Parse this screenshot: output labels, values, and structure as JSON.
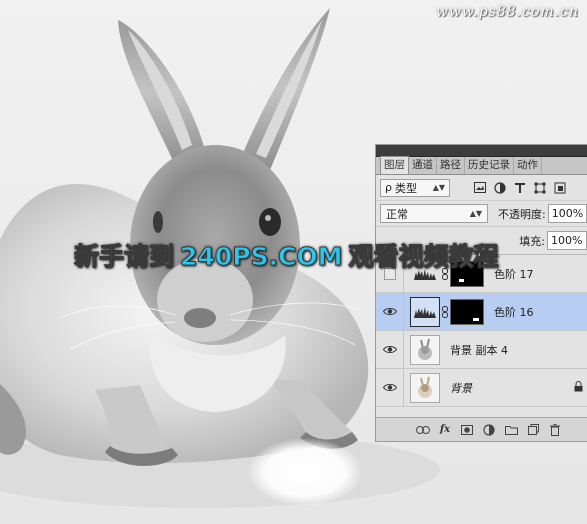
{
  "site_watermark": "www.ps88.com.cn",
  "overlay_text": {
    "part1": "新手请到",
    "part2": "240PS.COM",
    "part3": "观看视频教程"
  },
  "colors": {
    "overlay_accent": "#29c6ee",
    "selected_row": "#b7cdf1",
    "panel_bg": "#e3e3e3"
  },
  "panel": {
    "tabs": [
      {
        "label": "图层",
        "active": true
      },
      {
        "label": "通道",
        "active": false
      },
      {
        "label": "路径",
        "active": false
      },
      {
        "label": "历史记录",
        "active": false
      },
      {
        "label": "动作",
        "active": false
      }
    ],
    "filter": {
      "search_glyph": "ρ",
      "kind_value": "类型",
      "icons": [
        "image-filter-icon",
        "adjustment-filter-icon",
        "type-filter-icon",
        "shape-filter-icon",
        "smart-object-filter-icon"
      ]
    },
    "blend_mode": "正常",
    "opacity_label": "不透明度:",
    "opacity_value": "100%",
    "fill_label": "填充:",
    "fill_value": "100%",
    "layers": [
      {
        "name": "色阶 17",
        "visible": false,
        "selected": false,
        "type": "levels-adjustment"
      },
      {
        "name": "色阶 16",
        "visible": true,
        "selected": true,
        "type": "levels-adjustment"
      },
      {
        "name": "背景 副本 4",
        "visible": true,
        "selected": false,
        "type": "pixel"
      },
      {
        "name": "背景",
        "visible": true,
        "selected": false,
        "type": "background",
        "locked": true
      }
    ],
    "bottom_icons": [
      "link-layers-icon",
      "fx-icon",
      "add-mask-icon",
      "new-adjustment-icon",
      "new-group-icon",
      "new-layer-icon",
      "delete-layer-icon"
    ],
    "fx_label": "fx"
  }
}
